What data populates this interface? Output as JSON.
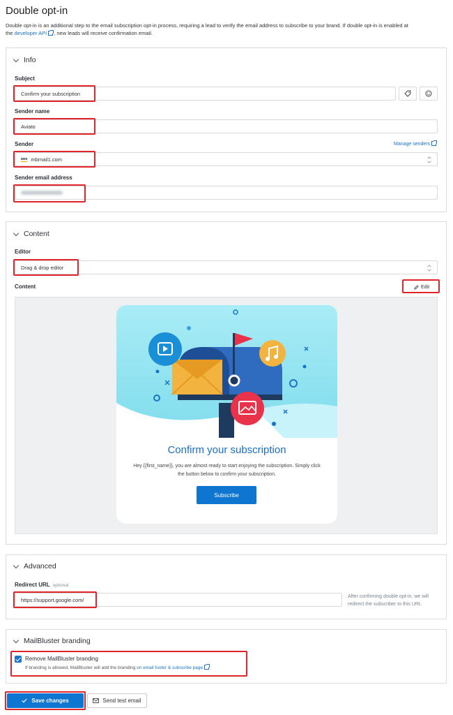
{
  "page": {
    "title": "Double opt-in",
    "desc_before_link": "Double opt-in is an additional step to the email subscription opt-in process, requiring a lead to verify the email address to subscribe to your brand. If double opt-in is enabled at the ",
    "desc_link": "developer API",
    "desc_after_link": ", new leads will receive confirmation email."
  },
  "info": {
    "heading": "Info",
    "subject_label": "Subject",
    "subject_value": "Confirm your subscription",
    "sender_name_label": "Sender name",
    "sender_name_value": "Aviato",
    "sender_label": "Sender",
    "manage_senders": "Manage senders",
    "sender_badge": "aws",
    "sender_value": "mbmail1.com",
    "sender_email_label": "Sender email address"
  },
  "content": {
    "heading": "Content",
    "editor_label": "Editor",
    "editor_value": "Drag & drop editor",
    "content_label": "Content",
    "edit_button": "Edit",
    "preview_title": "Confirm your subscription",
    "preview_body": "Hey {{first_name}}, you are almost ready to start enjoying the subscription. Simply click the button below to confirm your subscription.",
    "preview_button": "Subscribe"
  },
  "advanced": {
    "heading": "Advanced",
    "redirect_label": "Redirect URL",
    "redirect_optional": "optional",
    "redirect_value": "https://support.google.com/",
    "redirect_help": "After confirming double opt-in, we will redirect the subscriber to this URL"
  },
  "branding": {
    "heading": "MailBluster branding",
    "checkbox_label": "Remove MailBluster branding",
    "checkbox_checked": true,
    "help_before_link": "If branding is allowed, MailBluster will add the branding ",
    "help_link": "on email footer & subscribe page"
  },
  "actions": {
    "save": "Save changes",
    "test": "Send test email"
  },
  "colors": {
    "accent": "#0e76d1",
    "highlight": "#e2252b"
  }
}
